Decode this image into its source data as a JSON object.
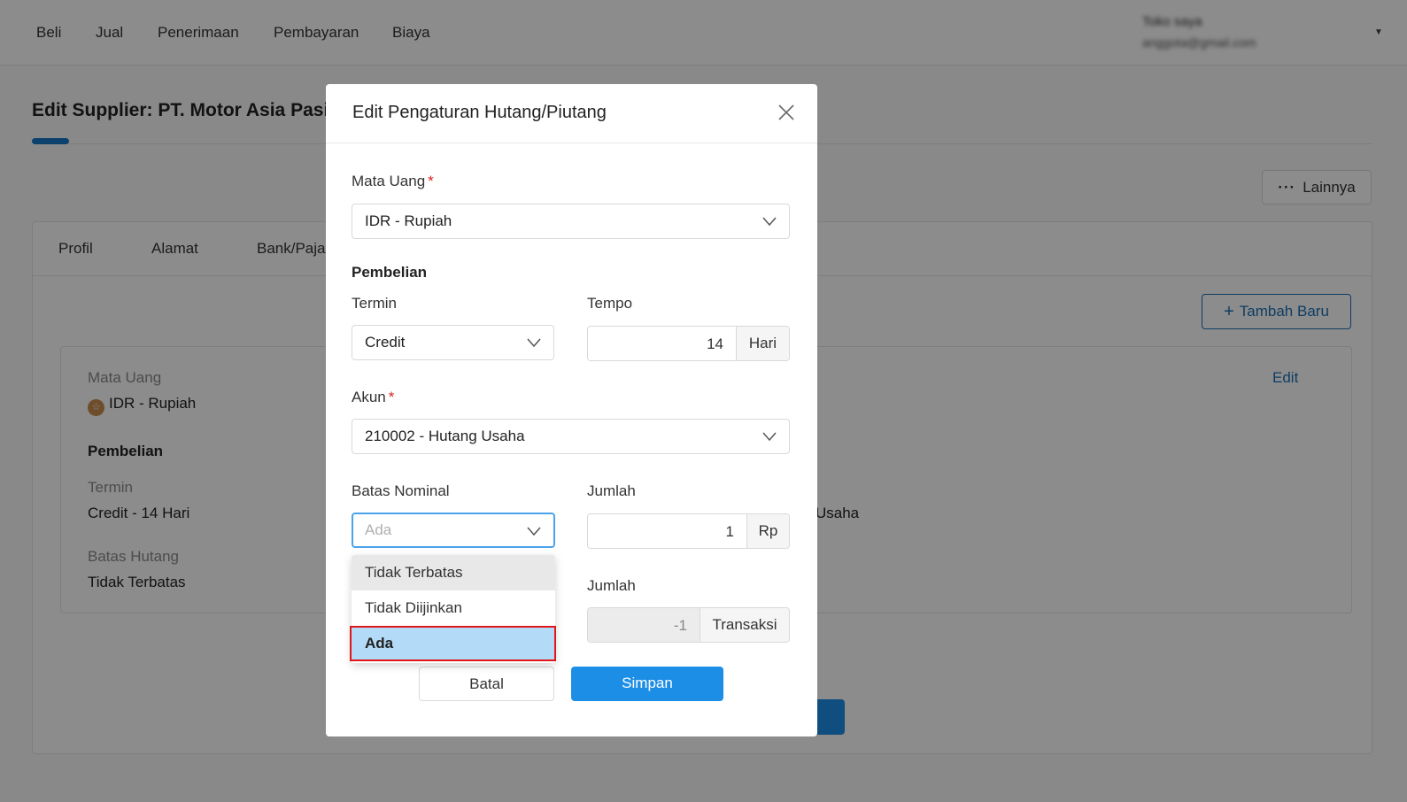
{
  "topnav": {
    "items": [
      "Beli",
      "Jual",
      "Penerimaan",
      "Pembayaran",
      "Biaya"
    ],
    "user_name": "Toko saya",
    "user_email": "anggota@gmail.com"
  },
  "page": {
    "title": "Edit Supplier: PT. Motor Asia Pasi",
    "more_label": "Lainnya",
    "tabs": [
      "Profil",
      "Alamat",
      "Bank/Paja"
    ],
    "add_label": "Tambah Baru",
    "edit_label": "Edit",
    "currency_label": "Mata Uang",
    "currency_value": "IDR - Rupiah",
    "purchase_heading": "Pembelian",
    "term_label": "Termin",
    "term_value": "Credit - 14 Hari",
    "limit_label": "Batas Hutang",
    "limit_value": "Tidak Terbatas",
    "account_value_partial": "Usaha"
  },
  "modal": {
    "title": "Edit Pengaturan Hutang/Piutang",
    "currency_label": "Mata Uang",
    "currency_value": "IDR - Rupiah",
    "purchase_heading": "Pembelian",
    "term_label": "Termin",
    "term_value": "Credit",
    "due_label": "Tempo",
    "due_value": "14",
    "due_unit": "Hari",
    "account_label": "Akun",
    "account_value": "210002 - Hutang Usaha",
    "limit_label": "Batas Nominal",
    "limit_placeholder": "Ada",
    "amount_label": "Jumlah",
    "amount_value": "1",
    "amount_unit": "Rp",
    "amount2_label": "Jumlah",
    "amount2_value": "-1",
    "amount2_unit": "Transaksi",
    "cancel_label": "Batal",
    "save_label": "Simpan",
    "limit_options": [
      "Tidak Terbatas",
      "Tidak Diijinkan",
      "Ada"
    ]
  },
  "colors": {
    "primary": "#1d8ee6",
    "link": "#1a6fb3",
    "selected_option": "#b3daf6",
    "highlight_border": "#e0161b",
    "required": "#e02020"
  }
}
